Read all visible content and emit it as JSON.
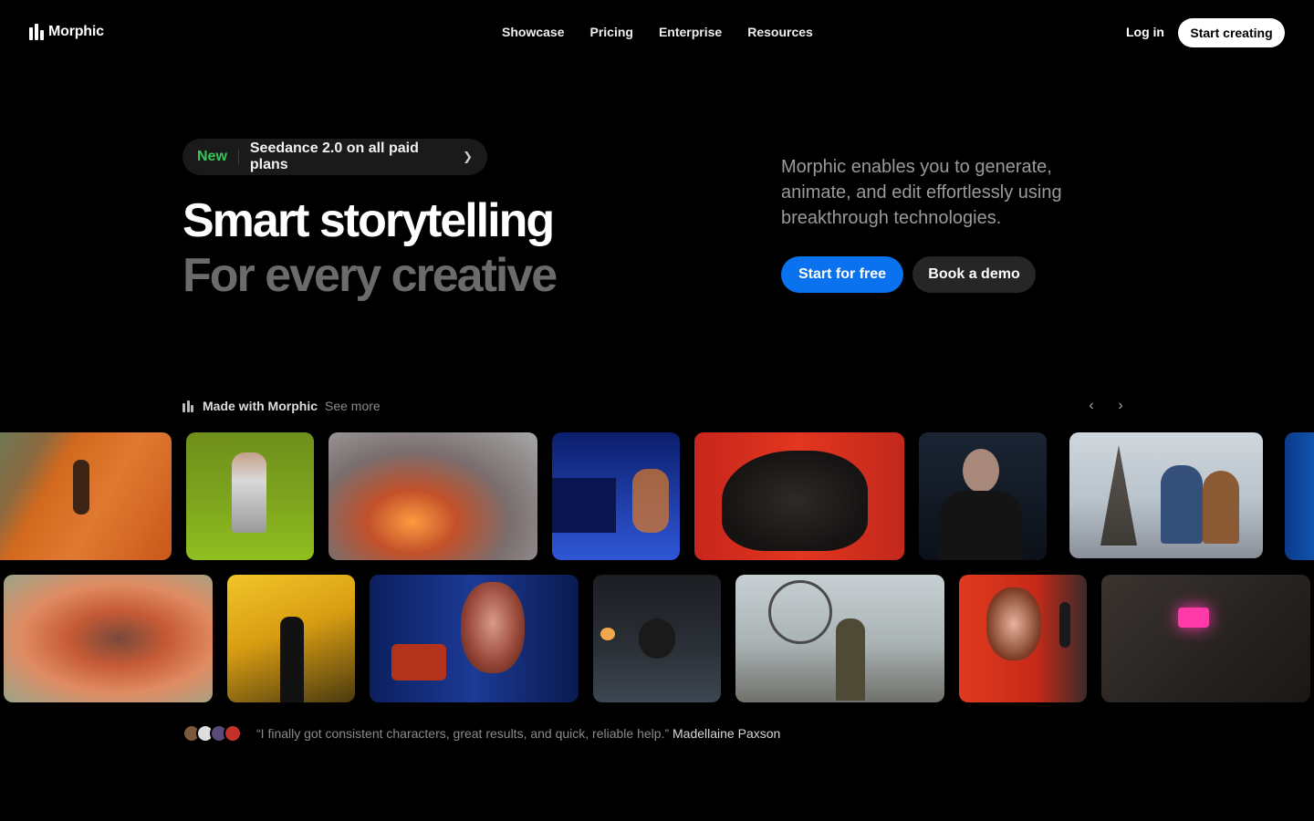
{
  "nav": {
    "brand": "Morphic",
    "links": [
      "Showcase",
      "Pricing",
      "Enterprise",
      "Resources"
    ],
    "login": "Log in",
    "cta": "Start creating"
  },
  "hero": {
    "badge": "New",
    "announcement": "Seedance 2.0 on all paid plans",
    "headline": "Smart storytelling",
    "subheadline": "For every creative",
    "description": "Morphic enables you to generate, animate, and edit effortlessly using breakthrough technologies.",
    "primary_cta": "Start for free",
    "secondary_cta": "Book a demo"
  },
  "gallery": {
    "label": "Made with Morphic",
    "see_more": "See more"
  },
  "testimonial": {
    "quote": "“I finally got consistent characters, great results, and quick, reliable help.”",
    "author": "Madellaine Paxson"
  },
  "colors": {
    "background": "#000000",
    "accent": "#0a72ef",
    "new_badge": "#34c759"
  }
}
